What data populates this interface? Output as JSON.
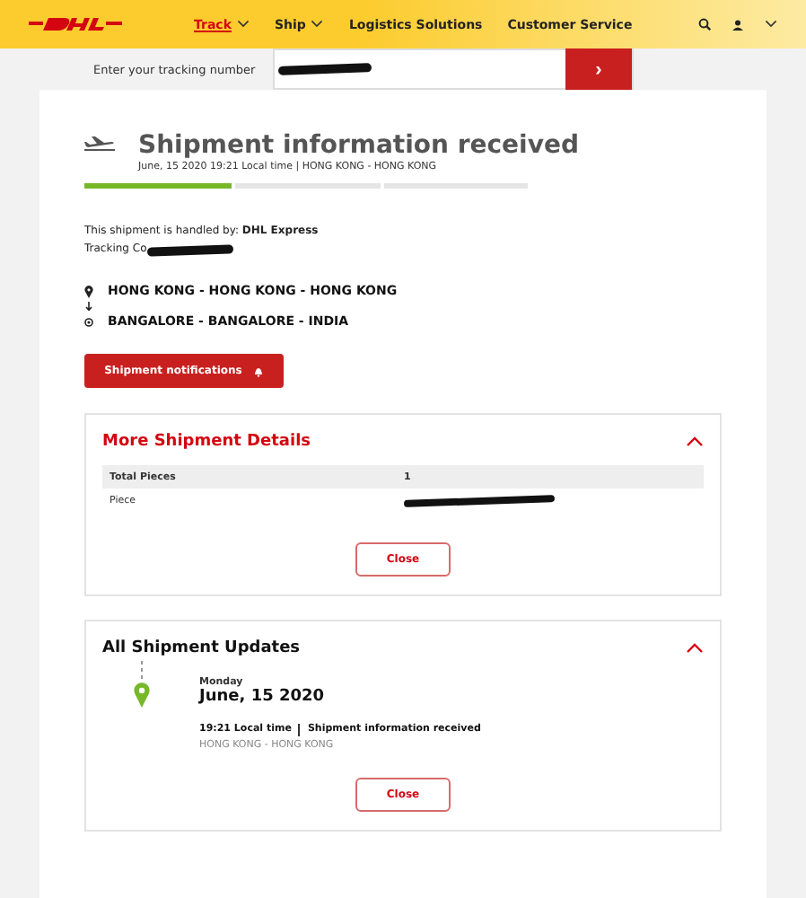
{
  "nav": {
    "items": [
      {
        "label": "Track",
        "selected": true,
        "dropdown": true
      },
      {
        "label": "Ship",
        "selected": false,
        "dropdown": true
      },
      {
        "label": "Logistics Solutions",
        "selected": false,
        "dropdown": false
      },
      {
        "label": "Customer Service",
        "selected": false,
        "dropdown": false
      }
    ]
  },
  "tracking_bar": {
    "label": "Enter your tracking number",
    "button": "›"
  },
  "status": {
    "title": "Shipment information received",
    "subtitle": "June, 15 2020 19:21 Local time | HONG KONG - HONG KONG",
    "progress": {
      "level": 0.33
    }
  },
  "handled_by": {
    "label": "This shipment is handled by: ",
    "value": "DHL Express"
  },
  "tracking_code": {
    "label": "Tracking Co"
  },
  "route": {
    "origin": "HONG KONG - HONG KONG - HONG KONG",
    "destination": "BANGALORE - BANGALORE - INDIA"
  },
  "notifications_button": "Shipment notifications",
  "details_panel": {
    "title": "More Shipment Details",
    "expanded": true,
    "rows": [
      {
        "label": "Total Pieces",
        "value": "1",
        "header": true
      },
      {
        "label": "Piece",
        "value": "",
        "header": false
      }
    ],
    "close": "Close"
  },
  "updates_panel": {
    "title": "All Shipment Updates",
    "expanded": true,
    "day": "Monday",
    "date": "June, 15 2020",
    "time": "19:21 Local time",
    "event": "Shipment information received",
    "location": "HONG KONG - HONG KONG",
    "close": "Close"
  }
}
